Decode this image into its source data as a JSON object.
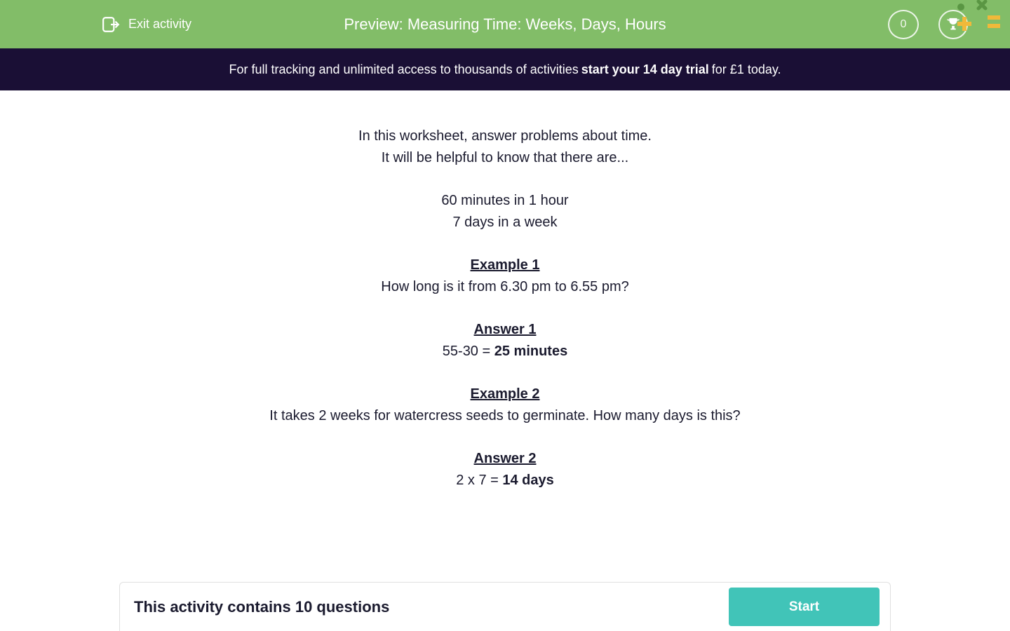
{
  "header": {
    "exit_label": "Exit activity",
    "title": "Preview: Measuring Time: Weeks, Days, Hours",
    "score": "0"
  },
  "banner": {
    "pre": "For full tracking and unlimited access to thousands of activities ",
    "bold": "start your 14 day trial",
    "post": " for £1 today."
  },
  "content": {
    "intro_line1": "In this worksheet, answer problems about time.",
    "intro_line2": "It will be helpful to know that there are...",
    "fact1": "60 minutes in 1 hour",
    "fact2": "7 days in a week",
    "example1_heading": "Example 1",
    "example1_text": "How long is it from 6.30 pm to 6.55 pm?",
    "answer1_heading": "Answer 1",
    "answer1_pre": "55-30 = ",
    "answer1_bold": "25 minutes",
    "example2_heading": "Example 2",
    "example2_text": "It takes 2 weeks for watercress seeds to germinate.  How many days is this?",
    "answer2_heading": "Answer 2",
    "answer2_pre": "2 x 7 = ",
    "answer2_bold": "14 days"
  },
  "footer": {
    "text": "This activity contains 10 questions",
    "button": "Start"
  },
  "colors": {
    "header_bg": "#82bd68",
    "banner_bg": "#1a0f35",
    "accent": "#41c4b8"
  }
}
